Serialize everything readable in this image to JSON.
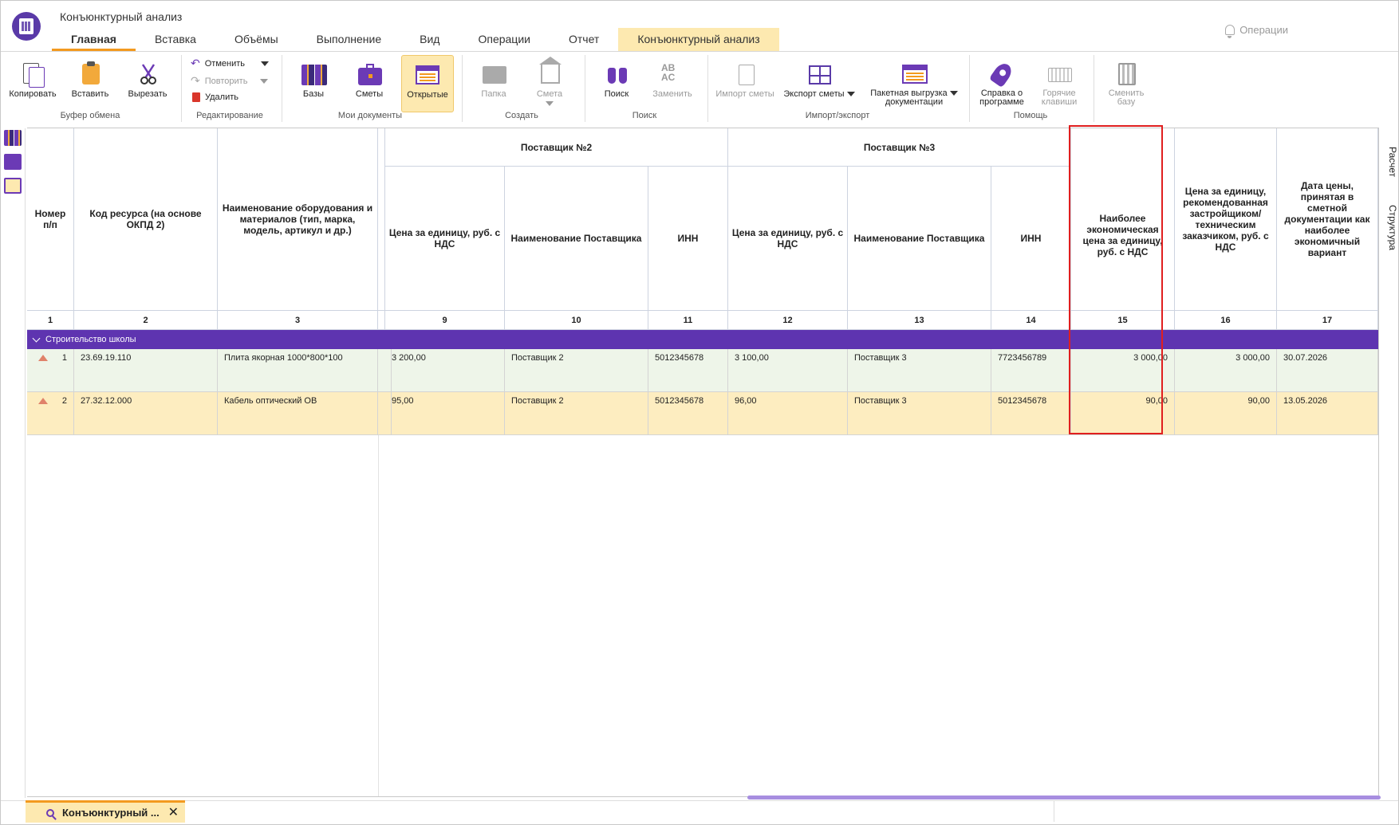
{
  "app": {
    "title": "Конъюнктурный анализ",
    "operations_label": "Операции"
  },
  "tabs": [
    {
      "label": "Главная",
      "active": true
    },
    {
      "label": "Вставка"
    },
    {
      "label": "Объёмы"
    },
    {
      "label": "Выполнение"
    },
    {
      "label": "Вид"
    },
    {
      "label": "Операции"
    },
    {
      "label": "Отчет"
    },
    {
      "label": "Конъюнктурный анализ",
      "context": true
    }
  ],
  "ribbon": {
    "clipboard": {
      "copy": "Копировать",
      "paste": "Вставить",
      "cut": "Вырезать",
      "label": "Буфер обмена"
    },
    "edit": {
      "undo": "Отменить",
      "redo": "Повторить",
      "delete": "Удалить",
      "label": "Редактирование"
    },
    "my_docs": {
      "bases": "Базы",
      "estimates": "Сметы",
      "opened": "Открытые",
      "label": "Мои документы"
    },
    "create": {
      "folder": "Папка",
      "estimate": "Смета",
      "label": "Создать"
    },
    "search": {
      "find": "Поиск",
      "replace": "Заменить",
      "label": "Поиск",
      "replace_icon_text": "AB\nAC"
    },
    "import_export": {
      "import": "Импорт сметы",
      "export": "Экспорт сметы",
      "batch_line1": "Пакетная выгрузка",
      "batch_line2": "документации",
      "label": "Импорт/экспорт"
    },
    "help": {
      "about_line1": "Справка о",
      "about_line2": "программе",
      "hotkeys_line1": "Горячие",
      "hotkeys_line2": "клавиши",
      "label": "Помощь"
    },
    "change_base": {
      "line1": "Сменить",
      "line2": "базу"
    }
  },
  "side_tabs": {
    "calc": "Расчет",
    "structure": "Структура"
  },
  "grid": {
    "headers": {
      "num": "Номер п/п",
      "code": "Код ресурса (на основе ОКПД 2)",
      "name": "Наименование оборудования и материалов (тип, марка, модель, артикул и др.)",
      "supplier2": "Поставщик №2",
      "supplier3": "Поставщик №3",
      "price": "Цена за единицу, руб. с НДС",
      "supplier_name": "Наименование Поставщика",
      "inn": "ИНН",
      "best_price": "Наиболее экономическая цена за единицу, руб. с НДС",
      "recommended": "Цена за единицу, рекомендованная застройщиком/ техническим заказчиком, руб. с НДС",
      "date": "Дата цены, принятая в сметной документации как наиболее экономичный вариант"
    },
    "col_numbers": [
      "1",
      "2",
      "3",
      "9",
      "10",
      "11",
      "12",
      "13",
      "14",
      "15",
      "16",
      "17"
    ],
    "group": "Строительство школы",
    "rows": [
      {
        "n": "1",
        "code": "23.69.19.110",
        "name": "Плита якорная 1000*800*100",
        "p2": "3 200,00",
        "s2": "Поставщик 2",
        "inn2": "5012345678",
        "p3": "3 100,00",
        "s3": "Поставщик 3",
        "inn3": "7723456789",
        "best": "3 000,00",
        "rec": "3 000,00",
        "date": "30.07.2026",
        "color": "#eef5e9"
      },
      {
        "n": "2",
        "code": "27.32.12.000",
        "name": "Кабель оптический ОВ",
        "p2": "95,00",
        "s2": "Поставщик 2",
        "inn2": "5012345678",
        "p3": "96,00",
        "s3": "Поставщик 3",
        "inn3": "5012345678",
        "best": "90,00",
        "rec": "90,00",
        "date": "13.05.2026",
        "color": "#fdedc0"
      }
    ]
  },
  "bottom": {
    "doc_tab": "Конъюнктурный ..."
  },
  "colors": {
    "accent": "#5e34b0",
    "orange": "#f39a1f",
    "highlight": "#e01f1f"
  }
}
